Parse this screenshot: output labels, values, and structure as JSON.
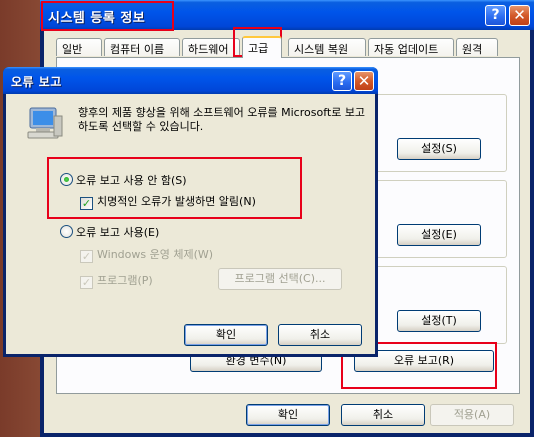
{
  "back_window": {
    "title": "시스템 등록 정보",
    "help_glyph": "?",
    "close_glyph": "✕",
    "tabs": [
      "일반",
      "컴퓨터 이름",
      "하드웨어",
      "고급",
      "시스템 복원",
      "자동 업데이트",
      "원격"
    ],
    "buttons": {
      "settings_s": "설정(S)",
      "settings_e": "설정(E)",
      "settings_t": "설정(T)",
      "env_vars": "환경 변수(N)",
      "error_report": "오류 보고(R)",
      "ok": "확인",
      "cancel": "취소",
      "apply": "적용(A)"
    }
  },
  "dialog": {
    "title": "오류 보고",
    "help_glyph": "?",
    "close_glyph": "✕",
    "message": "향후의 제품 향상을 위해 소프트웨어 오류를 Microsoft로 보고하도록 선택할 수 있습니다.",
    "radio_disable": "오류 보고 사용 안 함(S)",
    "check_critical": "치명적인 오류가 발생하면 알림(N)",
    "radio_enable": "오류 보고 사용(E)",
    "check_windows": "Windows 운영 체제(W)",
    "check_programs": "프로그램(P)",
    "choose_programs": "프로그램 선택(C)...",
    "ok": "확인",
    "cancel": "취소"
  },
  "colors": {
    "titlebar": "#0055ea",
    "dialog_bg": "#ece9d8",
    "highlight_box": "#e8001a"
  }
}
